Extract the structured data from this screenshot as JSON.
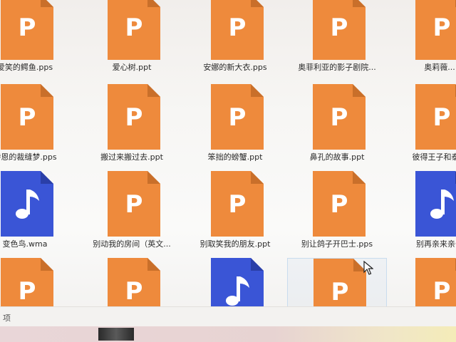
{
  "files": [
    {
      "name": "爱笑的鳄鱼.pps",
      "type": "ppt"
    },
    {
      "name": "爱心树.ppt",
      "type": "ppt"
    },
    {
      "name": "安娜的新大衣.pps",
      "type": "ppt"
    },
    {
      "name": "奥菲利亚的影子剧院...",
      "type": "ppt"
    },
    {
      "name": "奥莉薇...",
      "type": "ppt"
    },
    {
      "name": "特恩的裁缝梦.pps",
      "type": "ppt"
    },
    {
      "name": "搬过来搬过去.ppt",
      "type": "ppt"
    },
    {
      "name": "笨拙的螃蟹.ppt",
      "type": "ppt"
    },
    {
      "name": "鼻孔的故事.ppt",
      "type": "ppt"
    },
    {
      "name": "彼得王子和泰迪",
      "type": "ppt"
    },
    {
      "name": "变色鸟.wma",
      "type": "audio"
    },
    {
      "name": "别动我的房间（英文...",
      "type": "ppt"
    },
    {
      "name": "别取笑我的朋友.ppt",
      "type": "ppt"
    },
    {
      "name": "别让鸽子开巴士.pps",
      "type": "ppt"
    },
    {
      "name": "别再亲来亲去",
      "type": "audio"
    },
    {
      "name": "",
      "type": "ppt"
    },
    {
      "name": "",
      "type": "ppt"
    },
    {
      "name": "",
      "type": "audio"
    },
    {
      "name": "",
      "type": "ppt"
    },
    {
      "name": "",
      "type": "ppt"
    }
  ],
  "icon_letter": "P",
  "colors": {
    "ppt": "#ee8a3c",
    "ppt_fold": "#c96f2a",
    "audio": "#3a55d6",
    "audio_fold": "#2a3fa8"
  },
  "status_text": "项"
}
